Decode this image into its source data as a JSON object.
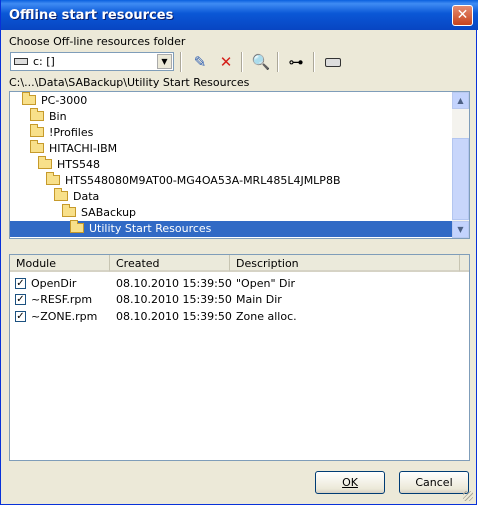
{
  "window": {
    "title": "Offline start resources"
  },
  "folder_label": "Choose Off-line resources folder",
  "drive_combo": {
    "value": "c: []"
  },
  "current_path": "C:\\...\\Data\\SABackup\\Utility Start Resources",
  "tree": {
    "items": [
      {
        "label": "PC-3000"
      },
      {
        "label": "Bin"
      },
      {
        "label": "!Profiles"
      },
      {
        "label": "HITACHI-IBM"
      },
      {
        "label": "HTS548"
      },
      {
        "label": "HTS548080M9AT00-MG4OA53A-MRL485L4JMLP8B"
      },
      {
        "label": "Data"
      },
      {
        "label": "SABackup"
      },
      {
        "label": "Utility Start Resources",
        "selected": true
      }
    ]
  },
  "list": {
    "columns": [
      "Module",
      "Created",
      "Description"
    ],
    "rows": [
      {
        "module": "OpenDir",
        "created": "08.10.2010 15:39:50",
        "description": "\"Open\" Dir",
        "checked": true
      },
      {
        "module": "~RESF.rpm",
        "created": "08.10.2010 15:39:50",
        "description": "Main Dir",
        "checked": true
      },
      {
        "module": "~ZONE.rpm",
        "created": "08.10.2010 15:39:50",
        "description": "Zone alloc.",
        "checked": true
      }
    ]
  },
  "buttons": {
    "ok": "OK",
    "cancel": "Cancel"
  },
  "colors": {
    "title_bar": "#0a57d6",
    "selection": "#316ac5",
    "close": "#c7431c"
  }
}
